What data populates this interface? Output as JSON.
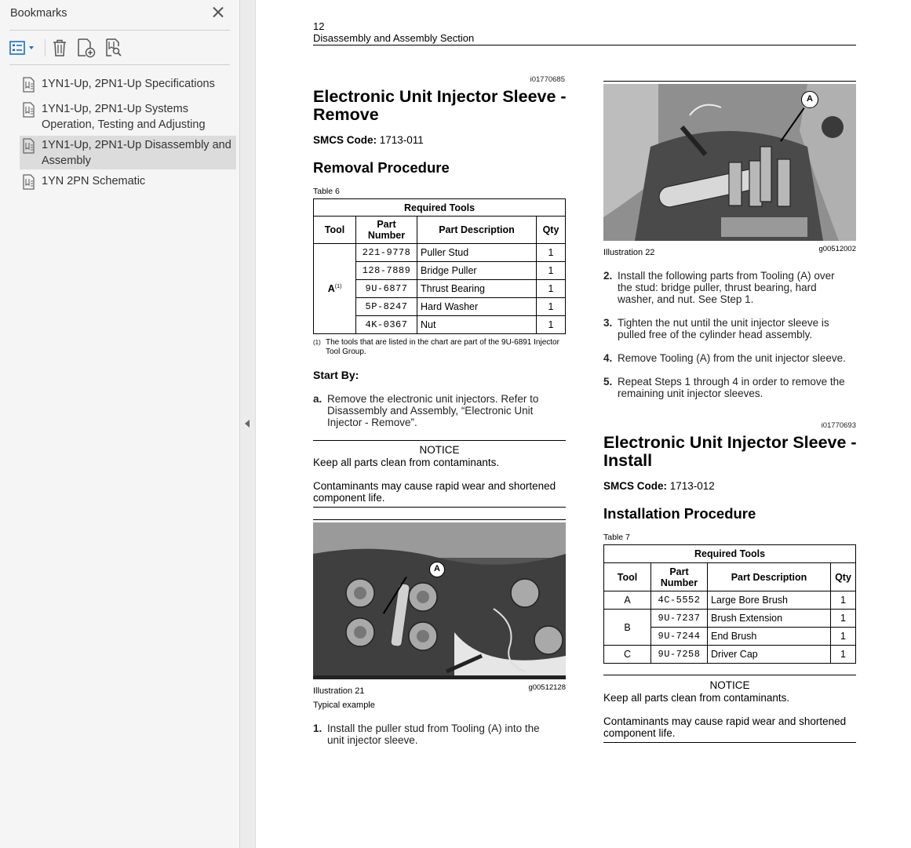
{
  "bookmarks_panel": {
    "title": "Bookmarks",
    "items": [
      {
        "label": "1YN1-Up, 2PN1-Up Specifications"
      },
      {
        "label": "1YN1-Up, 2PN1-Up Systems Operation, Testing and Adjusting"
      },
      {
        "label": "1YN1-Up, 2PN1-Up Disassembly and Assembly"
      },
      {
        "label": "1YN 2PN Schematic"
      }
    ]
  },
  "page": {
    "number": "12",
    "header": "Disassembly and Assembly Section",
    "left": {
      "ref_id": "i01770685",
      "title": "Electronic Unit Injector Sleeve - Remove",
      "smcs_label": "SMCS Code:",
      "smcs_value": "1713-011",
      "procedure_title": "Removal Procedure",
      "table_label": "Table 6",
      "table": {
        "caption": "Required Tools",
        "headers": [
          "Tool",
          "Part Number",
          "Part Description",
          "Qty"
        ],
        "tool": "A",
        "tool_sup": "(1)",
        "rows": [
          {
            "part": "221-9778",
            "desc": "Puller Stud",
            "qty": "1"
          },
          {
            "part": "128-7889",
            "desc": "Bridge Puller",
            "qty": "1"
          },
          {
            "part": "9U-6877",
            "desc": "Thrust Bearing",
            "qty": "1"
          },
          {
            "part": "5P-8247",
            "desc": "Hard Washer",
            "qty": "1"
          },
          {
            "part": "4K-0367",
            "desc": "Nut",
            "qty": "1"
          }
        ]
      },
      "footnote_mark": "(1)",
      "footnote": "The tools that are listed in the chart are part of the 9U-6891 Injector Tool Group.",
      "start_by": "Start By:",
      "start_step_letter": "a.",
      "start_step": "Remove the electronic unit injectors. Refer to Disassembly and Assembly, “Electronic Unit Injector - Remove”.",
      "notice_title": "NOTICE",
      "notice_1": "Keep all parts clean from contaminants.",
      "notice_2": "Contaminants may cause rapid wear and shortened component life.",
      "illustration_label": "Illustration 21",
      "illustration_id": "g00512128",
      "illustration_caption": "Typical example",
      "callout": "A",
      "step1_n": "1.",
      "step1": "Install the puller stud from Tooling (A) into the unit injector sleeve."
    },
    "right": {
      "callout": "A",
      "illustration_label": "Illustration 22",
      "illustration_id": "g00512002",
      "steps": [
        {
          "n": "2.",
          "text": "Install the following parts from Tooling (A) over the stud: bridge puller, thrust bearing, hard washer, and nut. See Step 1."
        },
        {
          "n": "3.",
          "text": "Tighten the nut until the unit injector sleeve is pulled free of the cylinder head assembly."
        },
        {
          "n": "4.",
          "text": "Remove Tooling (A) from the unit injector sleeve."
        },
        {
          "n": "5.",
          "text": "Repeat Steps 1 through 4 in order to remove the remaining unit injector sleeves."
        }
      ],
      "ref_id": "i01770693",
      "title": "Electronic Unit Injector Sleeve - Install",
      "smcs_label": "SMCS Code:",
      "smcs_value": "1713-012",
      "procedure_title": "Installation Procedure",
      "table_label": "Table 7",
      "table": {
        "caption": "Required Tools",
        "headers": [
          "Tool",
          "Part Number",
          "Part Description",
          "Qty"
        ],
        "rows": [
          {
            "tool": "A",
            "part": "4C-5552",
            "desc": "Large Bore Brush",
            "qty": "1"
          },
          {
            "tool": "B",
            "part": "9U-7237",
            "desc": "Brush Extension",
            "qty": "1"
          },
          {
            "tool": "",
            "part": "9U-7244",
            "desc": "End Brush",
            "qty": "1"
          },
          {
            "tool": "C",
            "part": "9U-7258",
            "desc": "Driver Cap",
            "qty": "1"
          }
        ]
      },
      "notice_title": "NOTICE",
      "notice_1": "Keep all parts clean from contaminants.",
      "notice_2": "Contaminants may cause rapid wear and shortened component life."
    }
  }
}
